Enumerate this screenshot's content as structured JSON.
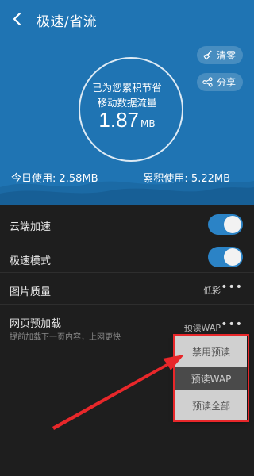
{
  "header": {
    "title": "极速/省流",
    "back_icon": "back-arrow-icon",
    "clear_label": "清零",
    "share_label": "分享",
    "circle_line1": "已为您累积节省",
    "circle_line2": "移动数据流量",
    "saved_value": "1.87",
    "saved_unit": "MB",
    "today_label": "今日使用: 2.58MB",
    "total_label": "累积使用: 5.22MB",
    "bg_color": "#1f74b3"
  },
  "settings": {
    "cloud_accel": {
      "label": "云端加速",
      "on": true
    },
    "speed_mode": {
      "label": "极速模式",
      "on": true
    },
    "image_quality": {
      "label": "图片质量",
      "value": "低彩"
    },
    "preload": {
      "label": "网页预加载",
      "sub": "提前加载下一页内容，上网更快",
      "value": "预读WAP"
    }
  },
  "dropdown": {
    "options": [
      "禁用预读",
      "预读WAP",
      "预读全部"
    ],
    "selected": "预读WAP",
    "highlight_color": "#e8272a"
  },
  "colors": {
    "toggle_on": "#2b83c6",
    "background": "#1e1e1e"
  }
}
